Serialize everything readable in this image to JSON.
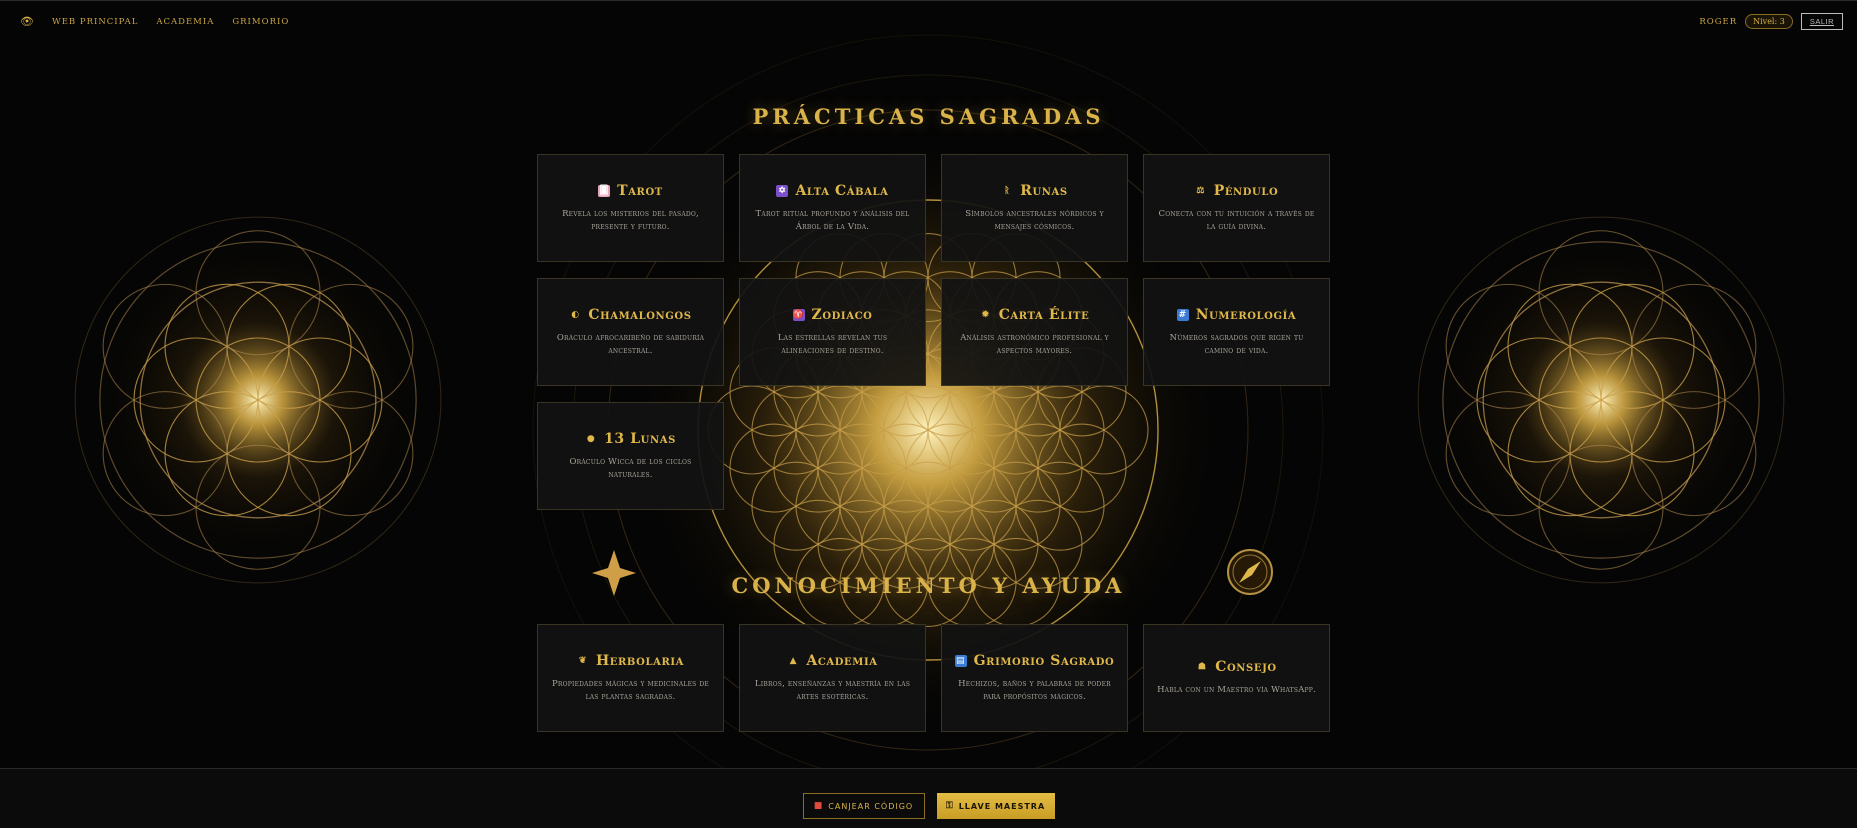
{
  "nav": {
    "eye_icon": "eye-icon",
    "links": [
      "Web principal",
      "Academia",
      "Grimorio"
    ],
    "user": "Roger",
    "level": "Nivel: 3",
    "logout": "Salir"
  },
  "practices": {
    "title": "Prácticas Sagradas",
    "cards": [
      {
        "icon": "tarot-card-icon",
        "glyph": "🂠",
        "icon_color": "#e8a4b8",
        "title": "Tarot",
        "desc": "Revela los misterios del pasado, presente y futuro."
      },
      {
        "icon": "star-of-david-icon",
        "glyph": "✡",
        "icon_color": "#7a4fc9",
        "title": "Alta Cábala",
        "desc": "Tarot ritual profundo y análisis del Árbol de la Vida."
      },
      {
        "icon": "rune-icon",
        "glyph": "ᚱ",
        "icon_color": "transparent",
        "title": "Runas",
        "desc": "Símbolos ancestrales nórdicos y mensajes cósmicos."
      },
      {
        "icon": "scale-icon",
        "glyph": "⚖",
        "icon_color": "transparent",
        "title": "Péndulo",
        "desc": "Conecta con tu intuición a través de la guía divina."
      },
      {
        "icon": "shell-icon",
        "glyph": "◐",
        "icon_color": "transparent",
        "title": "Chamalongos",
        "desc": "Oráculo afrocaribeño de sabiduría ancestral."
      },
      {
        "icon": "aries-icon",
        "glyph": "♈",
        "icon_color": "#7a4fc9",
        "title": "Zodiaco",
        "desc": "Las estrellas revelan tus alineaciones de destino."
      },
      {
        "icon": "sun-icon",
        "glyph": "✹",
        "icon_color": "transparent",
        "title": "Carta Élite",
        "desc": "Análisis astronómico profesional y aspectos mayores."
      },
      {
        "icon": "numbers-icon",
        "glyph": "#",
        "icon_color": "#3a7bd5",
        "title": "Numerología",
        "desc": "Números sagrados que rigen tu camino de vida."
      },
      {
        "icon": "moon-icon",
        "glyph": "●",
        "icon_color": "transparent",
        "title": "13 Lunas",
        "desc": "Oráculo Wicca de los ciclos naturales."
      }
    ]
  },
  "knowledge": {
    "title": "Conocimiento y Ayuda",
    "cards": [
      {
        "icon": "herb-icon",
        "glyph": "❦",
        "icon_color": "transparent",
        "title": "Herbolaria",
        "desc": "Propiedades mágicas y medicinales de las plantas sagradas."
      },
      {
        "icon": "graduation-cap-icon",
        "glyph": "▲",
        "icon_color": "transparent",
        "title": "Academia",
        "desc": "Libros, enseñanzas y maestría en las artes esotéricas."
      },
      {
        "icon": "book-icon",
        "glyph": "▤",
        "icon_color": "#3a7bd5",
        "title": "Grimorio Sagrado",
        "desc": "Hechizos, baños y palabras de poder para propósitos mágicos."
      },
      {
        "icon": "advisor-icon",
        "glyph": "☗",
        "icon_color": "transparent",
        "title": "Consejo",
        "desc": "Habla con un Maestro vía WhatsApp."
      }
    ]
  },
  "footer": {
    "redeem": "Canjear código",
    "master_key": "Llave maestra"
  },
  "colors": {
    "gold": "#d9b24a",
    "background": "#050505",
    "card_bg": "#121212",
    "text_muted": "#a9a49a"
  }
}
